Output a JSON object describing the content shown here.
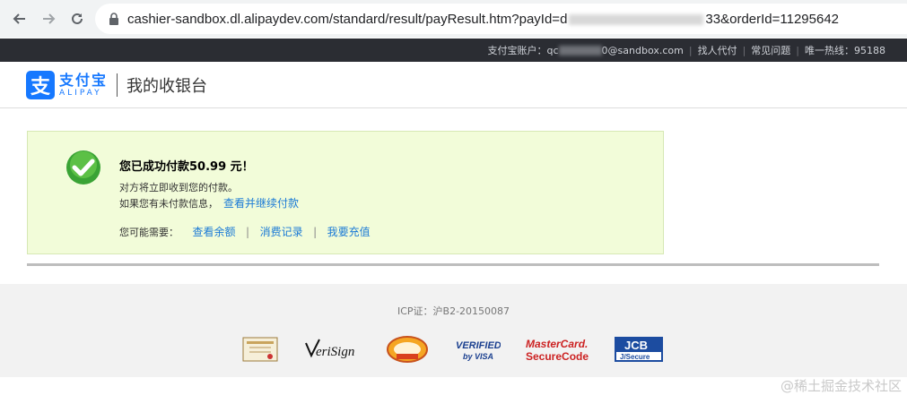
{
  "browser": {
    "url_prefix": "cashier-sandbox.dl.alipaydev.com/standard/result/payResult.htm?payId=d",
    "url_suffix": "33&orderId=11295642"
  },
  "topbar": {
    "account_label": "支付宝账户：",
    "account_prefix": "qc",
    "account_suffix": "0@sandbox.com",
    "link_agent": "找人代付",
    "link_faq": "常见问题",
    "hotline": "唯一热线：95188"
  },
  "header": {
    "logo_cn": "支付宝",
    "logo_en": "ALIPAY",
    "title": "我的收银台"
  },
  "result": {
    "title": "您已成功付款50.99 元！",
    "line1": "对方将立即收到您的付款。",
    "line2_text": "如果您有未付款信息，",
    "line2_link": "查看并继续付款",
    "needs_label": "您可能需要：",
    "links": [
      "查看余额",
      "消费记录",
      "我要充值"
    ]
  },
  "footer": {
    "icp": "ICP证：沪B2-20150087",
    "badges": [
      "verisign-badge",
      "pci-dss-badge",
      "verified-by-visa-badge",
      "mastercard-securecode-badge",
      "jcb-jsecure-badge"
    ]
  },
  "watermark": "@稀土掘金技术社区",
  "colors": {
    "accent": "#1678ff",
    "link": "#1b7ad6",
    "success_bg": "#f2fcd9",
    "topbar": "#2b2d33"
  }
}
